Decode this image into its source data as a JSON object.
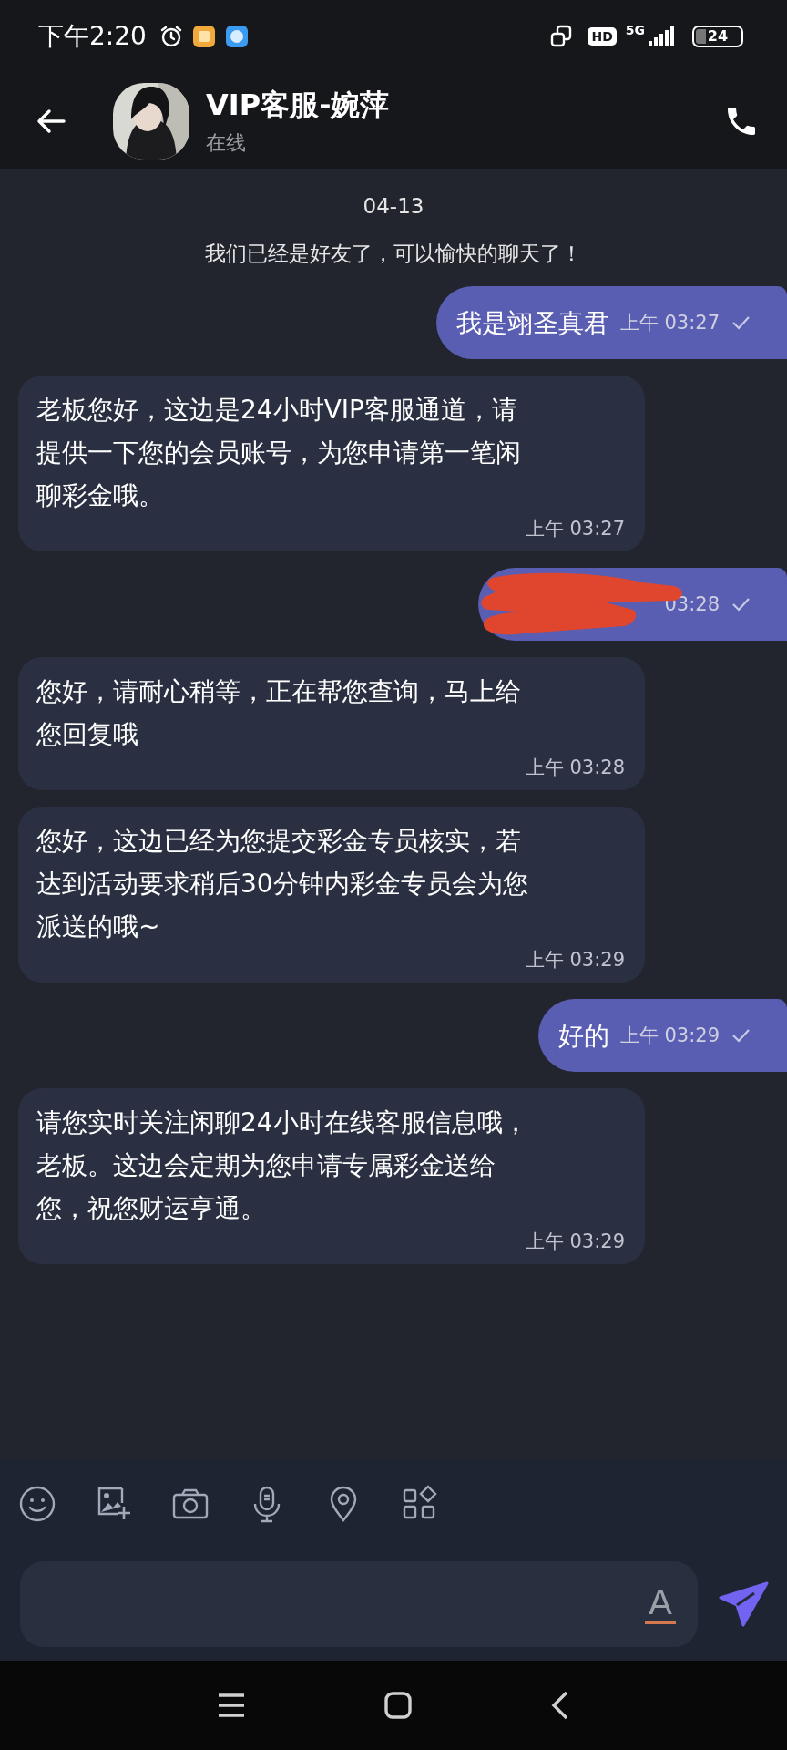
{
  "status_bar": {
    "time": "下午2:20",
    "hd": "HD",
    "network": "5G",
    "battery": "24"
  },
  "header": {
    "title": "VIP客服-婉萍",
    "subtitle": "在线"
  },
  "date": "04-13",
  "notice": "我们已经是好友了，可以愉快的聊天了！",
  "messages": [
    {
      "kind": "sent",
      "text": "我是翊圣真君",
      "time": "上午 03:27",
      "read": true
    },
    {
      "kind": "received",
      "text": "老板您好，这边是24小时VIP客服通道，请提供一下您的会员账号，为您申请第一笔闲聊彩金哦。",
      "time": "上午 03:27"
    },
    {
      "kind": "redacted",
      "time": "03:28",
      "read": true
    },
    {
      "kind": "received",
      "text": "您好，请耐心稍等，正在帮您查询，马上给您回复哦",
      "time": "上午 03:28"
    },
    {
      "kind": "received",
      "text": "您好，这边已经为您提交彩金专员核实，若达到活动要求稍后30分钟内彩金专员会为您派送的哦~",
      "time": "上午 03:29"
    },
    {
      "kind": "sent",
      "text": "好的",
      "time": "上午 03:29",
      "read": true
    },
    {
      "kind": "received",
      "text": "请您实时关注闲聊24小时在线客服信息哦，老板。这边会定期为您申请专属彩金送给您，祝您财运亨通。",
      "time": "上午 03:29"
    }
  ],
  "composer": {
    "format_key": "A"
  }
}
